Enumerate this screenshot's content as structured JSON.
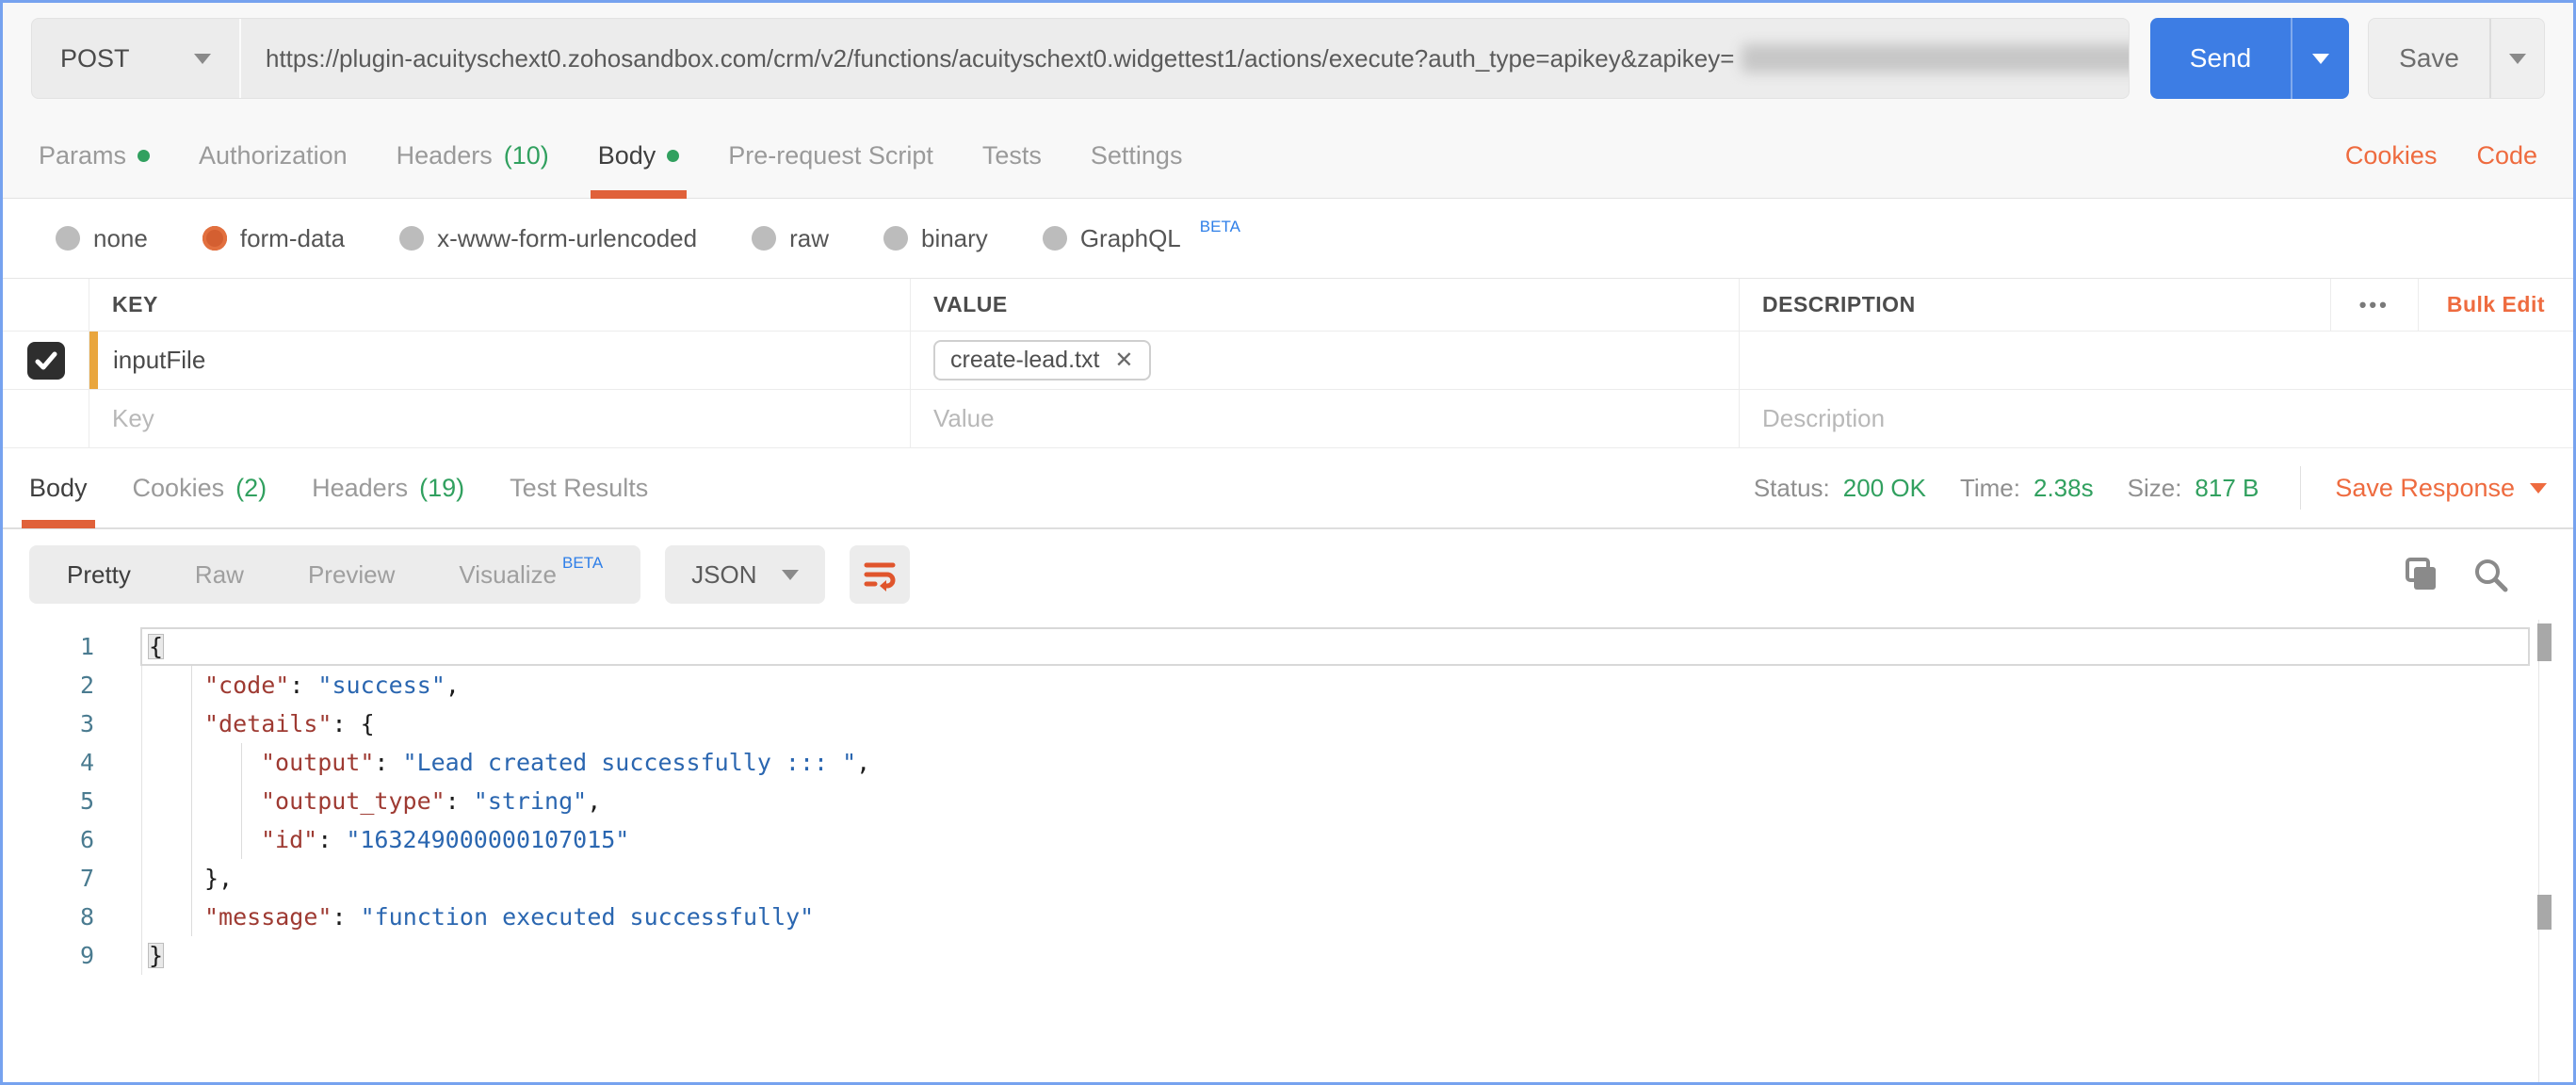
{
  "request_bar": {
    "method": "POST",
    "url": "https://plugin-acuityschext0.zohosandbox.com/crm/v2/functions/acuityschext0.widgettest1/actions/execute?auth_type=apikey&zapikey=",
    "url_redacted_suffix": "..",
    "send": "Send",
    "save": "Save"
  },
  "request_tabs": {
    "items": [
      {
        "label": "Params"
      },
      {
        "label": "Authorization"
      },
      {
        "label": "Headers",
        "count": "(10)"
      },
      {
        "label": "Body"
      },
      {
        "label": "Pre-request Script"
      },
      {
        "label": "Tests"
      },
      {
        "label": "Settings"
      }
    ],
    "active": "Body",
    "cookies": "Cookies",
    "code": "Code"
  },
  "body_types": {
    "options": [
      "none",
      "form-data",
      "x-www-form-urlencoded",
      "raw",
      "binary",
      "GraphQL"
    ],
    "selected": "form-data",
    "beta": "BETA"
  },
  "form_table": {
    "headers": {
      "key": "KEY",
      "value": "VALUE",
      "description": "DESCRIPTION"
    },
    "more": "•••",
    "bulk_edit": "Bulk Edit",
    "row": {
      "key": "inputFile",
      "file_chip": "create-lead.txt",
      "remove": "✕"
    },
    "placeholders": {
      "key": "Key",
      "value": "Value",
      "description": "Description"
    }
  },
  "response": {
    "tabs": [
      {
        "label": "Body"
      },
      {
        "label": "Cookies",
        "count": "(2)"
      },
      {
        "label": "Headers",
        "count": "(19)"
      },
      {
        "label": "Test Results"
      }
    ],
    "active": "Body",
    "status_label": "Status:",
    "status_value": "200 OK",
    "time_label": "Time:",
    "time_value": "2.38s",
    "size_label": "Size:",
    "size_value": "817 B",
    "save_response": "Save Response",
    "views": [
      "Pretty",
      "Raw",
      "Preview",
      "Visualize"
    ],
    "active_view": "Pretty",
    "beta": "BETA",
    "format": "JSON"
  },
  "code": {
    "lines": [
      {
        "num": "1",
        "open": "{"
      },
      {
        "num": "2",
        "key": "\"code\"",
        "colon": ": ",
        "val": "\"success\"",
        "comma": ","
      },
      {
        "num": "3",
        "key": "\"details\"",
        "colon": ": ",
        "open": "{"
      },
      {
        "num": "4",
        "key": "\"output\"",
        "colon": ": ",
        "val": "\"Lead created successfully ::: \"",
        "comma": ","
      },
      {
        "num": "5",
        "key": "\"output_type\"",
        "colon": ": ",
        "val": "\"string\"",
        "comma": ","
      },
      {
        "num": "6",
        "key": "\"id\"",
        "colon": ": ",
        "val": "\"163249000000107015\""
      },
      {
        "num": "7",
        "close": "},"
      },
      {
        "num": "8",
        "key": "\"message\"",
        "colon": ": ",
        "val": "\"function executed successfully\""
      },
      {
        "num": "9",
        "close": "}"
      }
    ]
  },
  "colors": {
    "accent_orange": "#ee6b3f",
    "success_green": "#31a05f",
    "send_blue": "#3d7de4",
    "row_marker_amber": "#e9a63e"
  }
}
